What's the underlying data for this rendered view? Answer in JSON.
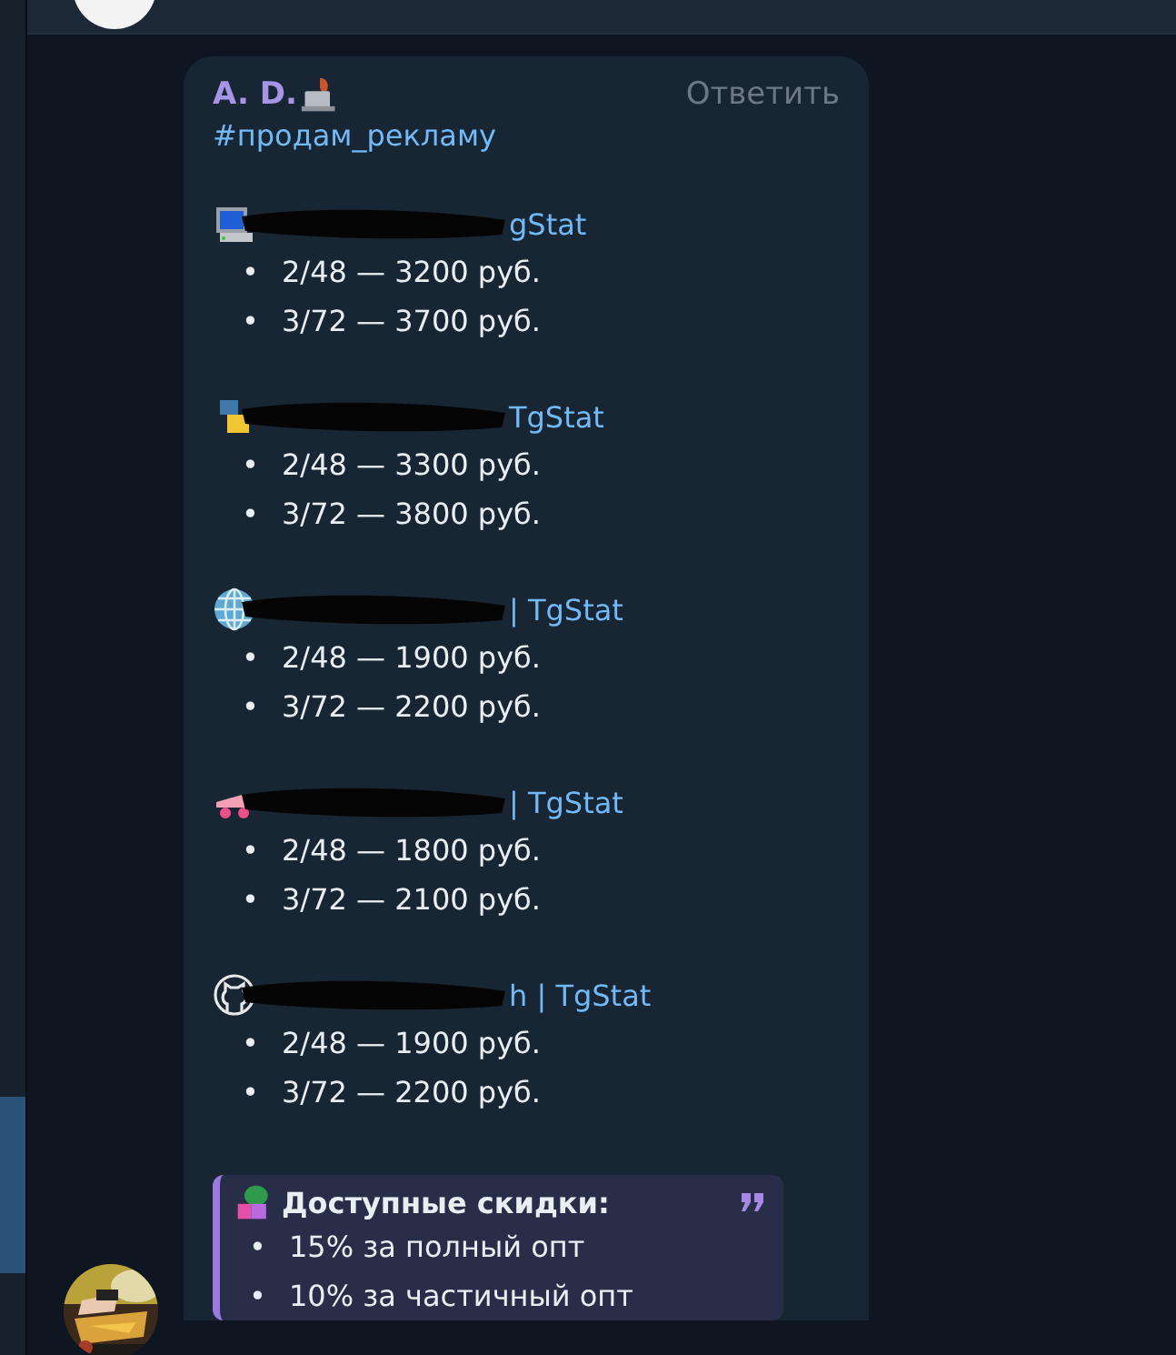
{
  "message": {
    "author": "A. D.",
    "reply_action": "Ответить",
    "hashtag": "#продам_рекламу",
    "channels": [
      {
        "kind": "computer",
        "link": "gStat",
        "prices": [
          {
            "marker": "•",
            "text": "2/48 — 3200 руб."
          },
          {
            "marker": "•",
            "text": "3/72 — 3700 руб."
          }
        ]
      },
      {
        "kind": "two-tone",
        "link": "TgStat",
        "prices": [
          {
            "marker": "•",
            "text": "2/48 — 3300 руб."
          },
          {
            "marker": "•",
            "text": "3/72 — 3800 руб."
          }
        ]
      },
      {
        "kind": "globe",
        "link": "| TgStat",
        "prices": [
          {
            "marker": "•",
            "text": "2/48 — 1900 руб."
          },
          {
            "marker": "•",
            "text": "3/72 — 2200 руб."
          }
        ]
      },
      {
        "kind": "vehicle",
        "link": "| TgStat",
        "prices": [
          {
            "marker": "•",
            "text": "2/48 — 1800 руб."
          },
          {
            "marker": "•",
            "text": "3/72 — 2100 руб."
          }
        ]
      },
      {
        "kind": "cat",
        "link": "h | TgStat",
        "prices": [
          {
            "marker": "•",
            "text": "2/48 — 1900 руб."
          },
          {
            "marker": "•",
            "text": "3/72 — 2200 руб."
          }
        ]
      }
    ],
    "quote": {
      "title": "Доступные скидки:",
      "items": [
        {
          "marker": "•",
          "text": "15% за полный опт"
        },
        {
          "marker": "•",
          "text": "10% за частичный опт"
        }
      ]
    }
  }
}
